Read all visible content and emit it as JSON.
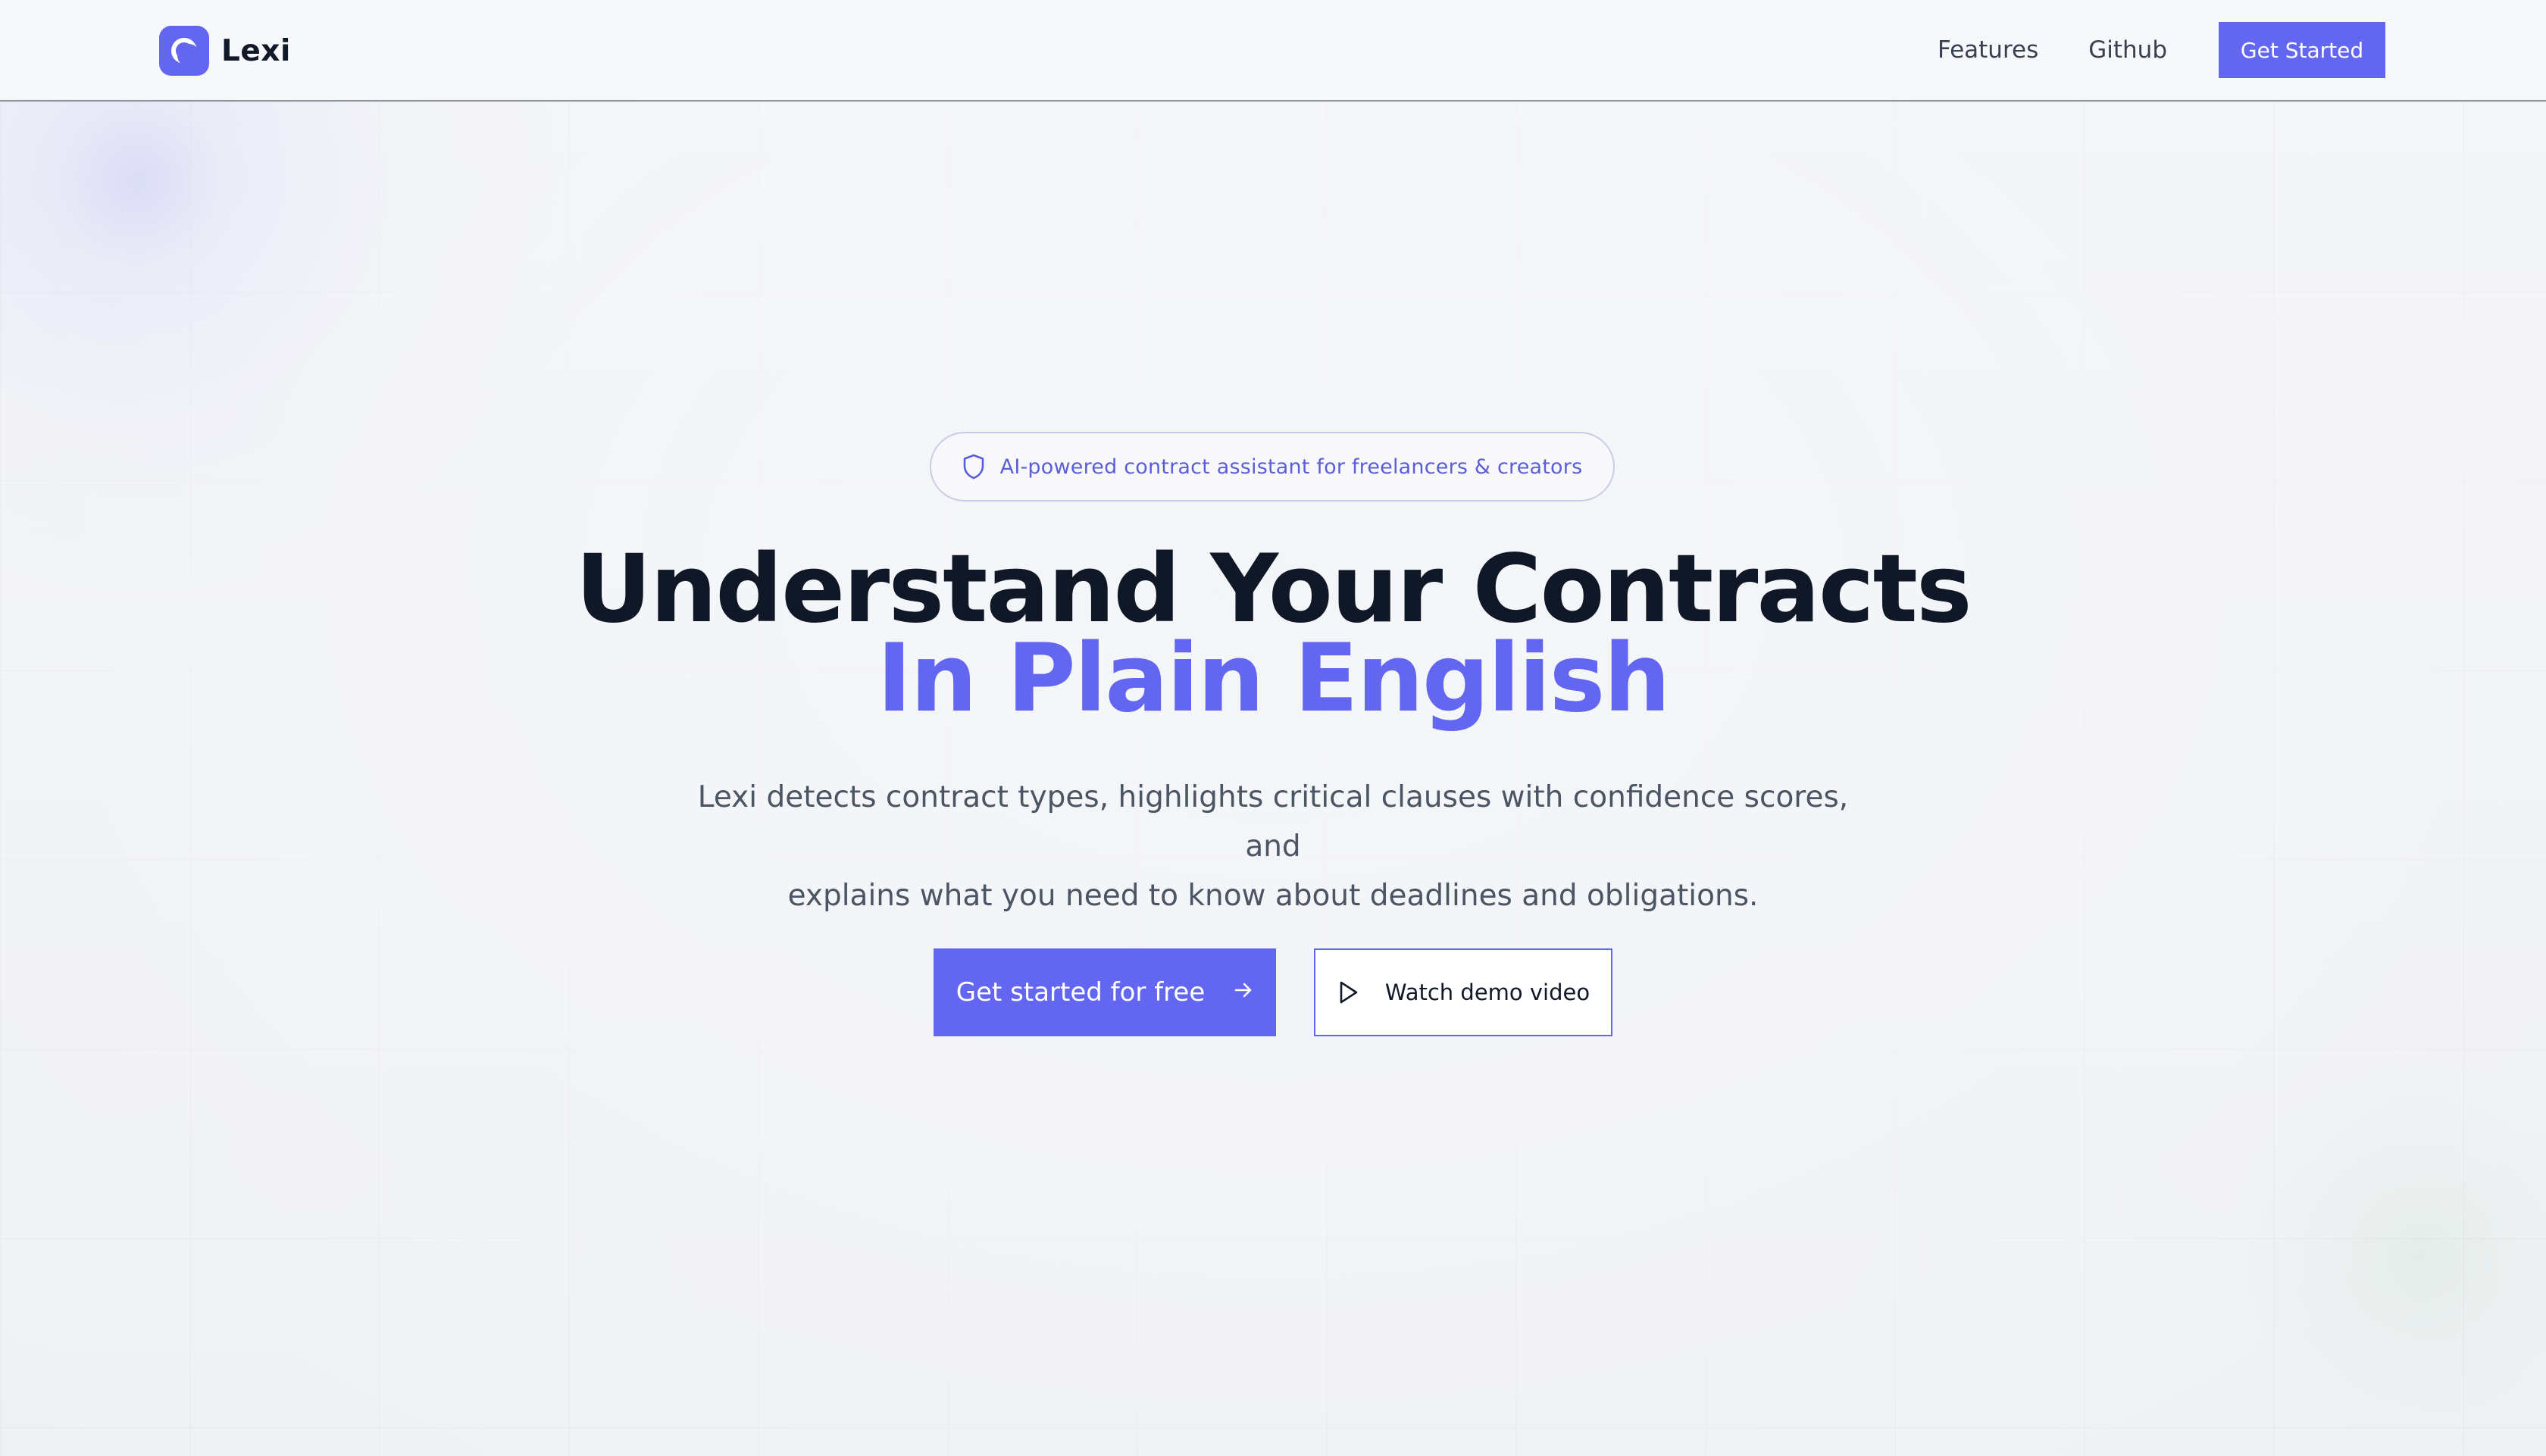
{
  "header": {
    "brand": "Lexi",
    "nav": [
      {
        "label": "Features"
      },
      {
        "label": "Github"
      }
    ],
    "cta": "Get Started"
  },
  "hero": {
    "badge": {
      "icon": "shield-icon",
      "text": "AI-powered contract assistant for freelancers & creators"
    },
    "title_line1": "Understand Your Contracts",
    "title_line2": "In Plain English",
    "subtitle_line1": "Lexi detects contract types, highlights critical clauses with confidence scores, and",
    "subtitle_line2": "explains what you need to know about deadlines and obligations.",
    "primary_button": {
      "label": "Get started for free",
      "icon": "arrow-right-icon"
    },
    "secondary_button": {
      "label": "Watch demo video",
      "icon": "play-icon"
    }
  },
  "colors": {
    "accent": "#6366f1",
    "heading": "#101828",
    "body_text": "#4b5563"
  }
}
